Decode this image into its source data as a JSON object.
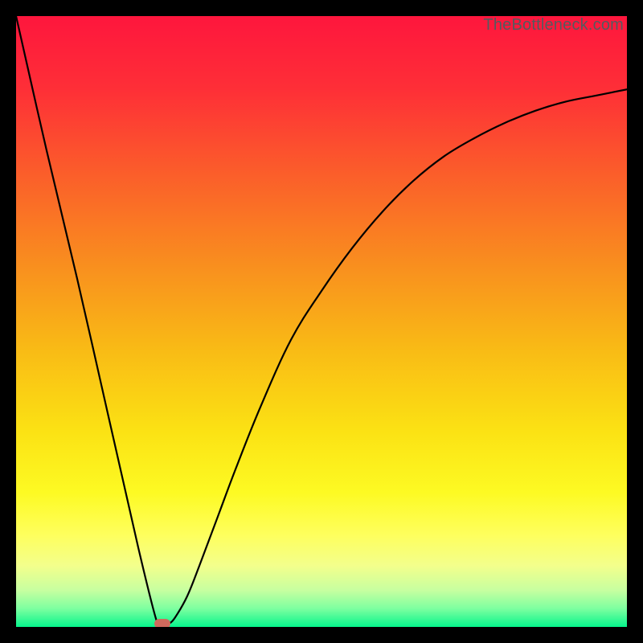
{
  "watermark": "TheBottleneck.com",
  "chart_data": {
    "type": "line",
    "title": "",
    "xlabel": "",
    "ylabel": "",
    "xlim": [
      0,
      100
    ],
    "ylim": [
      0,
      100
    ],
    "grid": false,
    "legend": false,
    "axis_ticks": false,
    "series": [
      {
        "name": "bottleneck-curve",
        "color": "#000000",
        "x": [
          0,
          5,
          10,
          15,
          20,
          23,
          24,
          25,
          26,
          28,
          30,
          33,
          36,
          40,
          45,
          50,
          55,
          60,
          65,
          70,
          75,
          80,
          85,
          90,
          95,
          100
        ],
        "y": [
          100,
          78,
          57,
          35,
          13,
          1,
          0,
          0.5,
          1.5,
          5,
          10,
          18,
          26,
          36,
          47,
          55,
          62,
          68,
          73,
          77,
          80,
          82.5,
          84.5,
          86,
          87,
          88
        ]
      }
    ],
    "marker": {
      "x_percent": 24,
      "y_percent": 0,
      "color": "#cf6a5d"
    },
    "background_gradient": {
      "type": "vertical",
      "stops": [
        {
          "pos": 0.0,
          "color": "#fe163d"
        },
        {
          "pos": 0.12,
          "color": "#fe2f37"
        },
        {
          "pos": 0.25,
          "color": "#fb5b2b"
        },
        {
          "pos": 0.4,
          "color": "#f98c1f"
        },
        {
          "pos": 0.55,
          "color": "#f9bc15"
        },
        {
          "pos": 0.68,
          "color": "#fbe214"
        },
        {
          "pos": 0.78,
          "color": "#fdfa23"
        },
        {
          "pos": 0.85,
          "color": "#feff5e"
        },
        {
          "pos": 0.9,
          "color": "#f3ff8c"
        },
        {
          "pos": 0.94,
          "color": "#c7ffa0"
        },
        {
          "pos": 0.97,
          "color": "#7dffa0"
        },
        {
          "pos": 1.0,
          "color": "#06f58c"
        }
      ]
    }
  }
}
